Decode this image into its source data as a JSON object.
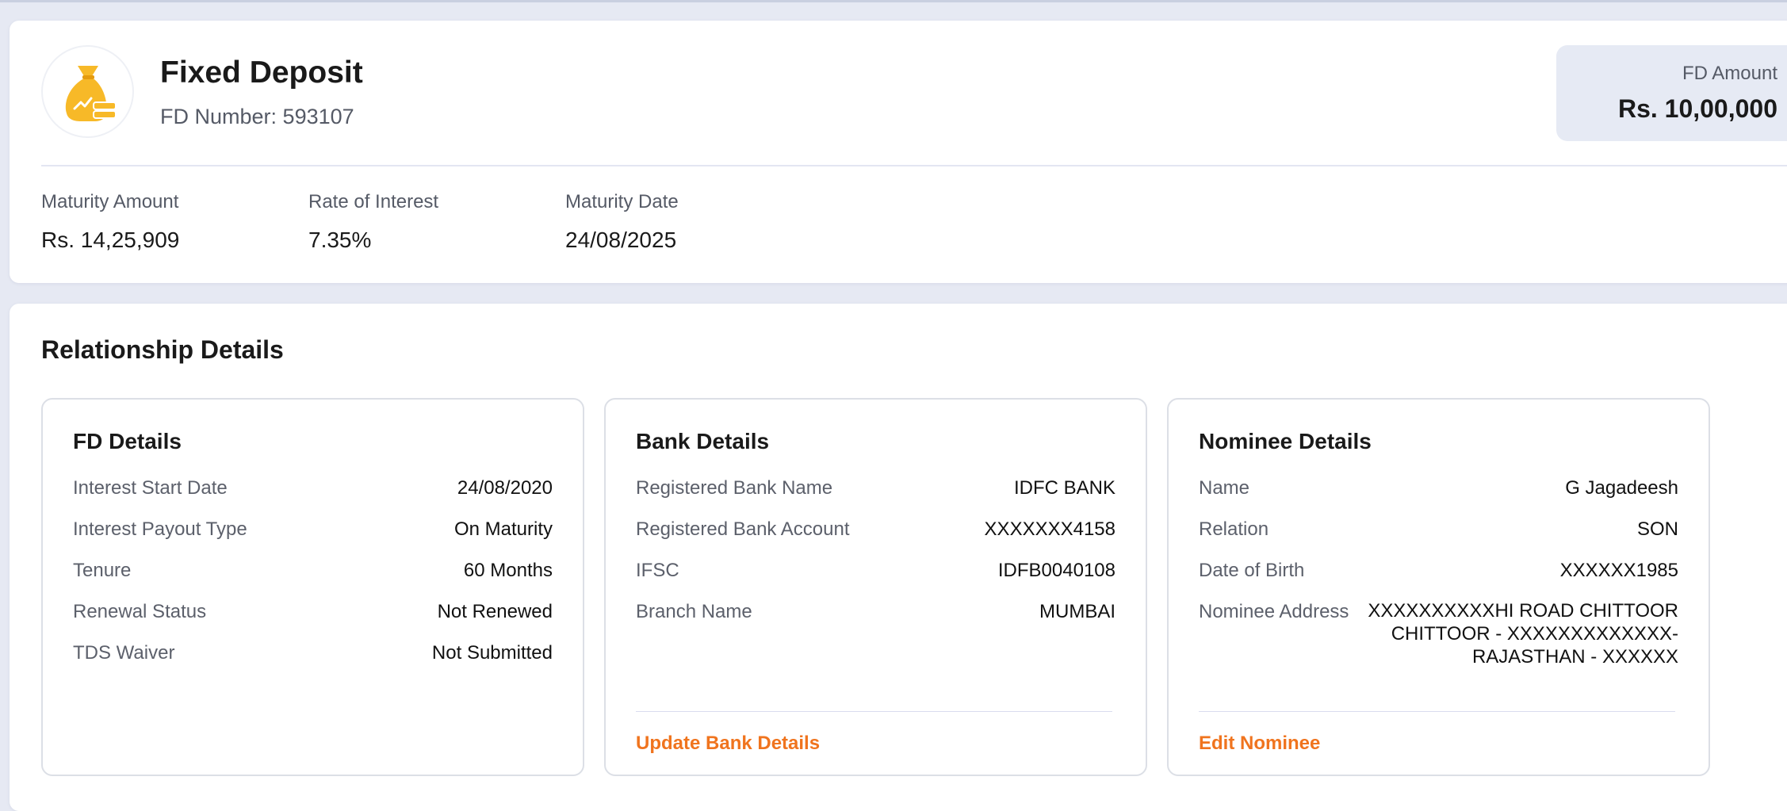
{
  "summary": {
    "title": "Fixed Deposit",
    "fd_number_label": "FD Number:",
    "fd_number": "593107",
    "fd_amount_label": "FD Amount",
    "fd_amount": "Rs. 10,00,000",
    "logo_icon": "money-bag-coins-icon",
    "stats": [
      {
        "label": "Maturity Amount",
        "value": "Rs. 14,25,909"
      },
      {
        "label": "Rate of Interest",
        "value": "7.35%"
      },
      {
        "label": "Maturity Date",
        "value": "24/08/2025"
      }
    ]
  },
  "relationship": {
    "title": "Relationship Details",
    "fd_details": {
      "title": "FD Details",
      "rows": [
        {
          "label": "Interest Start Date",
          "value": "24/08/2020"
        },
        {
          "label": "Interest Payout Type",
          "value": "On Maturity"
        },
        {
          "label": "Tenure",
          "value": "60 Months"
        },
        {
          "label": "Renewal Status",
          "value": "Not Renewed"
        },
        {
          "label": "TDS Waiver",
          "value": "Not Submitted"
        }
      ]
    },
    "bank_details": {
      "title": "Bank Details",
      "rows": [
        {
          "label": "Registered Bank Name",
          "value": "IDFC BANK"
        },
        {
          "label": "Registered Bank Account",
          "value": "XXXXXXX4158"
        },
        {
          "label": "IFSC",
          "value": "IDFB0040108"
        },
        {
          "label": "Branch Name",
          "value": "MUMBAI"
        }
      ],
      "action_label": "Update Bank Details"
    },
    "nominee_details": {
      "title": "Nominee Details",
      "rows": [
        {
          "label": "Name",
          "value": "G Jagadeesh"
        },
        {
          "label": "Relation",
          "value": "SON"
        },
        {
          "label": "Date of Birth",
          "value": "XXXXXX1985"
        },
        {
          "label": "Nominee Address",
          "value_lines": [
            "XXXXXXXXXXHI ROAD CHITTOOR",
            "CHITTOOR - XXXXXXXXXXXXX-",
            "RAJASTHAN - XXXXXX"
          ]
        }
      ],
      "action_label": "Edit Nominee"
    }
  },
  "colors": {
    "page_bg": "#e6e9f3",
    "accent_link": "#f0741e",
    "amount_box_bg": "#e6eaf4",
    "logo_gold": "#f7b928"
  }
}
